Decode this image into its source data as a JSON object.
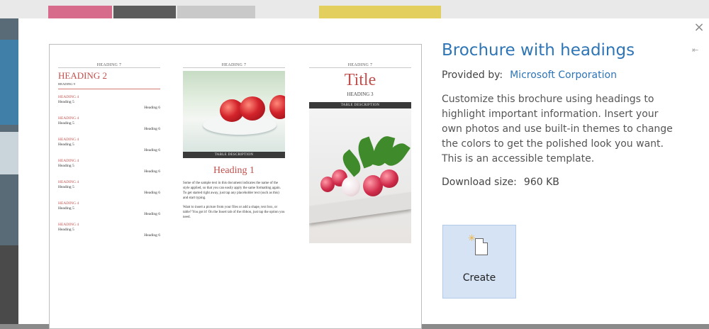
{
  "template": {
    "title": "Brochure with headings",
    "provided_by_label": "Provided by:",
    "provider": "Microsoft Corporation",
    "description": "Customize this brochure using headings to highlight important information. Insert your own photos and use built-in themes to change the colors to get the polished look you want. This is an accessible template.",
    "download_label": "Download size:",
    "download_size": "960 KB"
  },
  "buttons": {
    "close": "×",
    "pin": "⇤",
    "create_label": "Create",
    "create_icon": "new-document-icon"
  },
  "preview": {
    "col1": {
      "heading7": "HEADING 7",
      "heading2": "HEADING 2",
      "heading9": "HEADING 9",
      "toc": [
        {
          "h4": "HEADING 4",
          "h5": "Heading 5",
          "h6": "Heading 6"
        },
        {
          "h4": "HEADING 4",
          "h5": "Heading 5",
          "h6": "Heading 6"
        },
        {
          "h4": "HEADING 4",
          "h5": "Heading 5",
          "h6": "Heading 6"
        },
        {
          "h4": "HEADING 4",
          "h5": "Heading 5",
          "h6": "Heading 6"
        },
        {
          "h4": "HEADING 4",
          "h5": "Heading 5",
          "h6": "Heading 6"
        },
        {
          "h4": "HEADING 4",
          "h5": "Heading 5",
          "h6": "Heading 6"
        },
        {
          "h4": "HEADING 4",
          "h5": "Heading 5",
          "h6": "Heading 6"
        }
      ]
    },
    "col2": {
      "heading7": "HEADING 7",
      "table_description": "TABLE DESCRIPTION",
      "heading1": "Heading 1",
      "para1": "Some of the sample text in this document indicates the name of the style applied, so that you can easily apply the same formatting again. To get started right away, just tap any placeholder text (such as this) and start typing.",
      "para2": "Want to insert a picture from your files or add a shape, text box, or table? You got it! On the Insert tab of the ribbon, just tap the option you need."
    },
    "col3": {
      "heading7": "HEADING 7",
      "title": "Title",
      "heading3": "HEADING 3",
      "table_description": "TABLE DESCRIPTION"
    }
  },
  "colors": {
    "accent_blue": "#2e75b6",
    "heading_red": "#c0504d",
    "create_bg": "#d5e3f5"
  }
}
